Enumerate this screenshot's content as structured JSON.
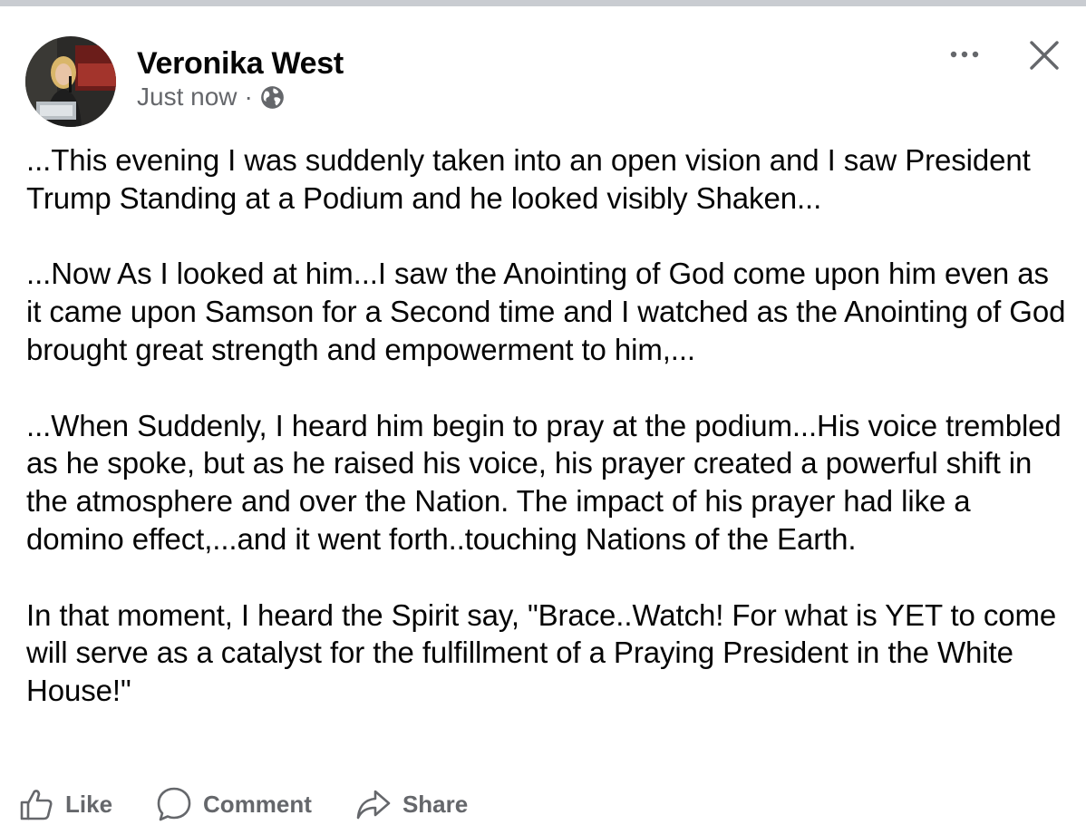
{
  "post": {
    "author": "Veronika West",
    "timestamp": "Just now",
    "separator": "·",
    "audience_icon": "globe-icon",
    "avatar_icon": "profile-photo",
    "more_icon": "more-options-icon",
    "close_icon": "close-icon",
    "paragraphs": [
      "...This evening I was suddenly taken into an open vision and I saw President Trump Standing at a Podium and he looked visibly Shaken...",
      "...Now As I looked at him...I saw the Anointing of God come upon him even as it came upon Samson for a Second time and I watched as the Anointing of God brought great strength and empowerment to him,...",
      "...When Suddenly, I heard him begin to pray at the podium...His voice trembled as he spoke, but as he raised his voice, his prayer created a powerful shift in the atmosphere and over the Nation. The impact of his prayer had like a domino effect,...and it went forth..touching Nations of the Earth.",
      "In that moment, I heard the Spirit say, \"Brace..Watch! For what is YET to come will serve as a catalyst for the fulfillment of a Praying President in the White House!\""
    ]
  },
  "actions": {
    "like_label": "Like",
    "comment_label": "Comment",
    "share_label": "Share",
    "like_icon": "thumbs-up-icon",
    "comment_icon": "comment-bubble-icon",
    "share_icon": "share-arrow-icon"
  },
  "colors": {
    "text_primary": "#050505",
    "text_secondary": "#65676b",
    "icon_gray": "#65676b",
    "top_bar": "#c9ccd1"
  }
}
